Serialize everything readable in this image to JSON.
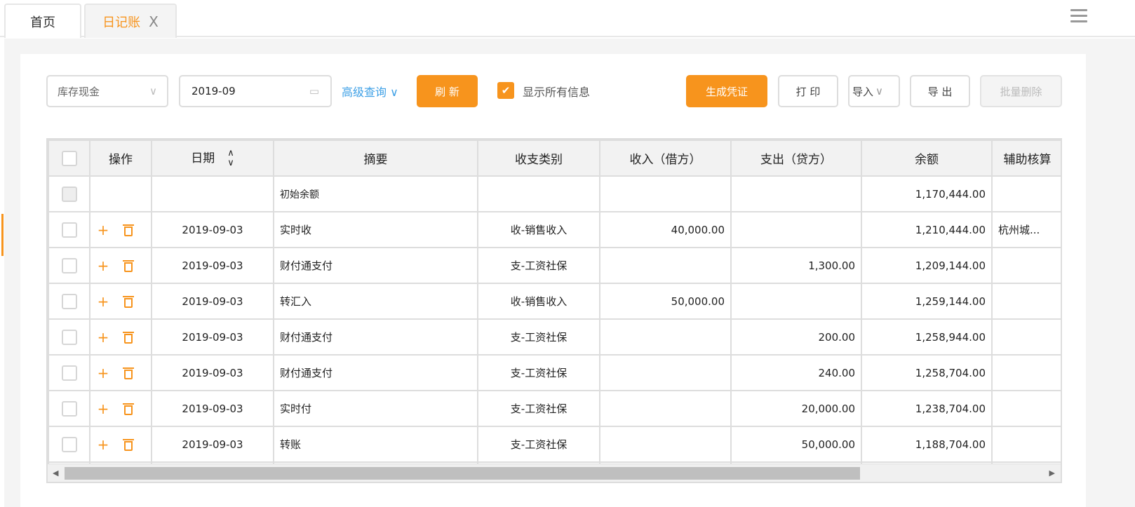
{
  "tabs": [
    {
      "label": "首页"
    },
    {
      "label": "日记账",
      "close": "X"
    }
  ],
  "toolbar": {
    "account": "库存现金",
    "period": "2019-09",
    "advanced": "高级查询",
    "refresh": "刷 新",
    "show_all": "显示所有信息",
    "show_all_checked": true,
    "generate": "生成凭证",
    "print": "打 印",
    "import": "导入",
    "export": "导 出",
    "batch_delete": "批量删除"
  },
  "colors": {
    "accent": "#f7941d",
    "link": "#3ea0e6"
  },
  "table": {
    "headers": [
      "",
      "操作",
      "日期",
      "摘要",
      "收支类别",
      "收入（借方）",
      "支出（贷方）",
      "余额",
      "辅助核算"
    ],
    "opening": {
      "summary": "初始余额",
      "balance": "1,170,444.00"
    },
    "rows": [
      {
        "date": "2019-09-03",
        "summary": "实时收",
        "category": "收-销售收入",
        "income": "40,000.00",
        "expense": "",
        "balance": "1,210,444.00",
        "aux": "杭州城..."
      },
      {
        "date": "2019-09-03",
        "summary": "财付通支付",
        "category": "支-工资社保",
        "income": "",
        "expense": "1,300.00",
        "balance": "1,209,144.00",
        "aux": ""
      },
      {
        "date": "2019-09-03",
        "summary": "转汇入",
        "category": "收-销售收入",
        "income": "50,000.00",
        "expense": "",
        "balance": "1,259,144.00",
        "aux": ""
      },
      {
        "date": "2019-09-03",
        "summary": "财付通支付",
        "category": "支-工资社保",
        "income": "",
        "expense": "200.00",
        "balance": "1,258,944.00",
        "aux": ""
      },
      {
        "date": "2019-09-03",
        "summary": "财付通支付",
        "category": "支-工资社保",
        "income": "",
        "expense": "240.00",
        "balance": "1,258,704.00",
        "aux": ""
      },
      {
        "date": "2019-09-03",
        "summary": "实时付",
        "category": "支-工资社保",
        "income": "",
        "expense": "20,000.00",
        "balance": "1,238,704.00",
        "aux": ""
      },
      {
        "date": "2019-09-03",
        "summary": "转账",
        "category": "支-工资社保",
        "income": "",
        "expense": "50,000.00",
        "balance": "1,188,704.00",
        "aux": ""
      }
    ]
  }
}
